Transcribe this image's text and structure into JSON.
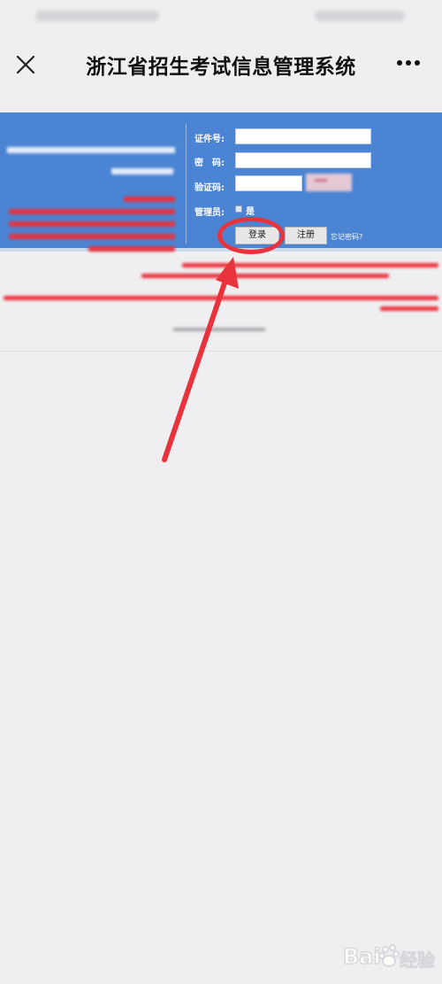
{
  "header": {
    "title": "浙江省招生考试信息管理系统"
  },
  "login_form": {
    "id_label": "证件号:",
    "password_label": "密　码:",
    "captcha_label": "验证码:",
    "admin_label": "管理员:",
    "admin_option": "是",
    "login_button": "登录",
    "register_button": "注册",
    "forgot_link": "忘记密码?"
  },
  "watermark": {
    "text": "经验"
  },
  "colors": {
    "banner": "#4a84d3",
    "annotation_red": "#e8323c",
    "page_bg": "#efeff1"
  },
  "icons": [
    "close-icon",
    "more-icon",
    "baidu-paw-icon"
  ]
}
